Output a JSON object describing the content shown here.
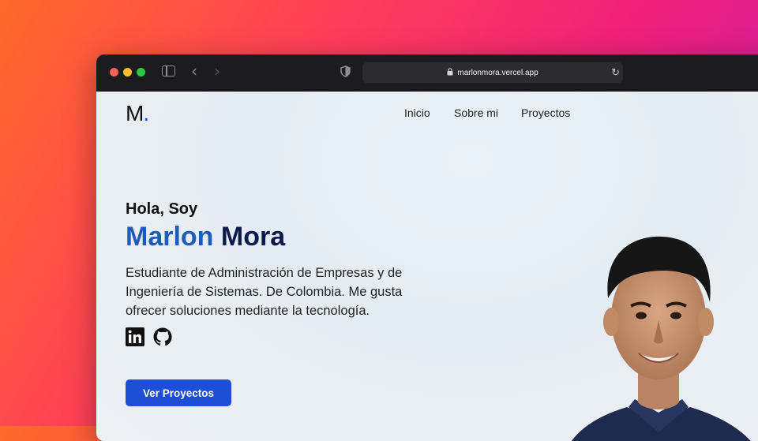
{
  "browser": {
    "url": "marlonmora.vercel.app",
    "icons": [
      "sidebar-icon",
      "back-icon",
      "forward-icon",
      "shield-icon",
      "lock-icon",
      "reload-icon"
    ]
  },
  "site": {
    "logo_letter": "M",
    "logo_dot": ".",
    "nav": [
      "Inicio",
      "Sobre mi",
      "Proyectos"
    ]
  },
  "hero": {
    "greeting": "Hola, Soy",
    "first_name": "Marlon",
    "last_name": "Mora",
    "description": "Estudiante de Administración de Empresas y de Ingeniería de Sistemas. De Colombia. Me gusta ofrecer soluciones mediante la tecnología.",
    "social_icons": [
      "linkedin-icon",
      "github-icon"
    ],
    "cta_label": "Ver Proyectos"
  },
  "colors": {
    "accent": "#1d4fd6",
    "name_first": "#1e5cb8",
    "name_last": "#0b1a4d"
  }
}
